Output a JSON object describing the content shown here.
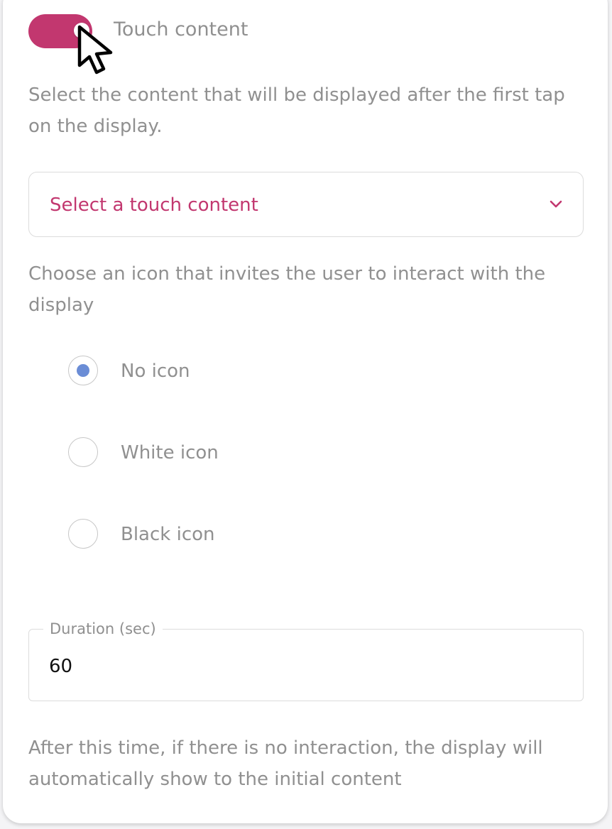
{
  "toggle": {
    "label": "Touch content",
    "checked": true,
    "color": "#c2376f"
  },
  "touch_content": {
    "help": "Select the content that will be displayed after the first tap on the display.",
    "select_placeholder": "Select a touch content",
    "chevron_icon": "chevron-down-icon"
  },
  "icon_choice": {
    "help": "Choose an icon that invites the user to interact with the display",
    "selected": "No icon",
    "accent_color": "#6b8dd6",
    "options": [
      {
        "label": "No icon",
        "selected": true
      },
      {
        "label": "White icon",
        "selected": false
      },
      {
        "label": "Black icon",
        "selected": false
      }
    ]
  },
  "duration": {
    "label": "Duration (sec)",
    "value": "60",
    "help": "After this time, if there is no interaction, the display will automatically show to the initial content"
  },
  "cursor_icon": "arrow-cursor-icon"
}
